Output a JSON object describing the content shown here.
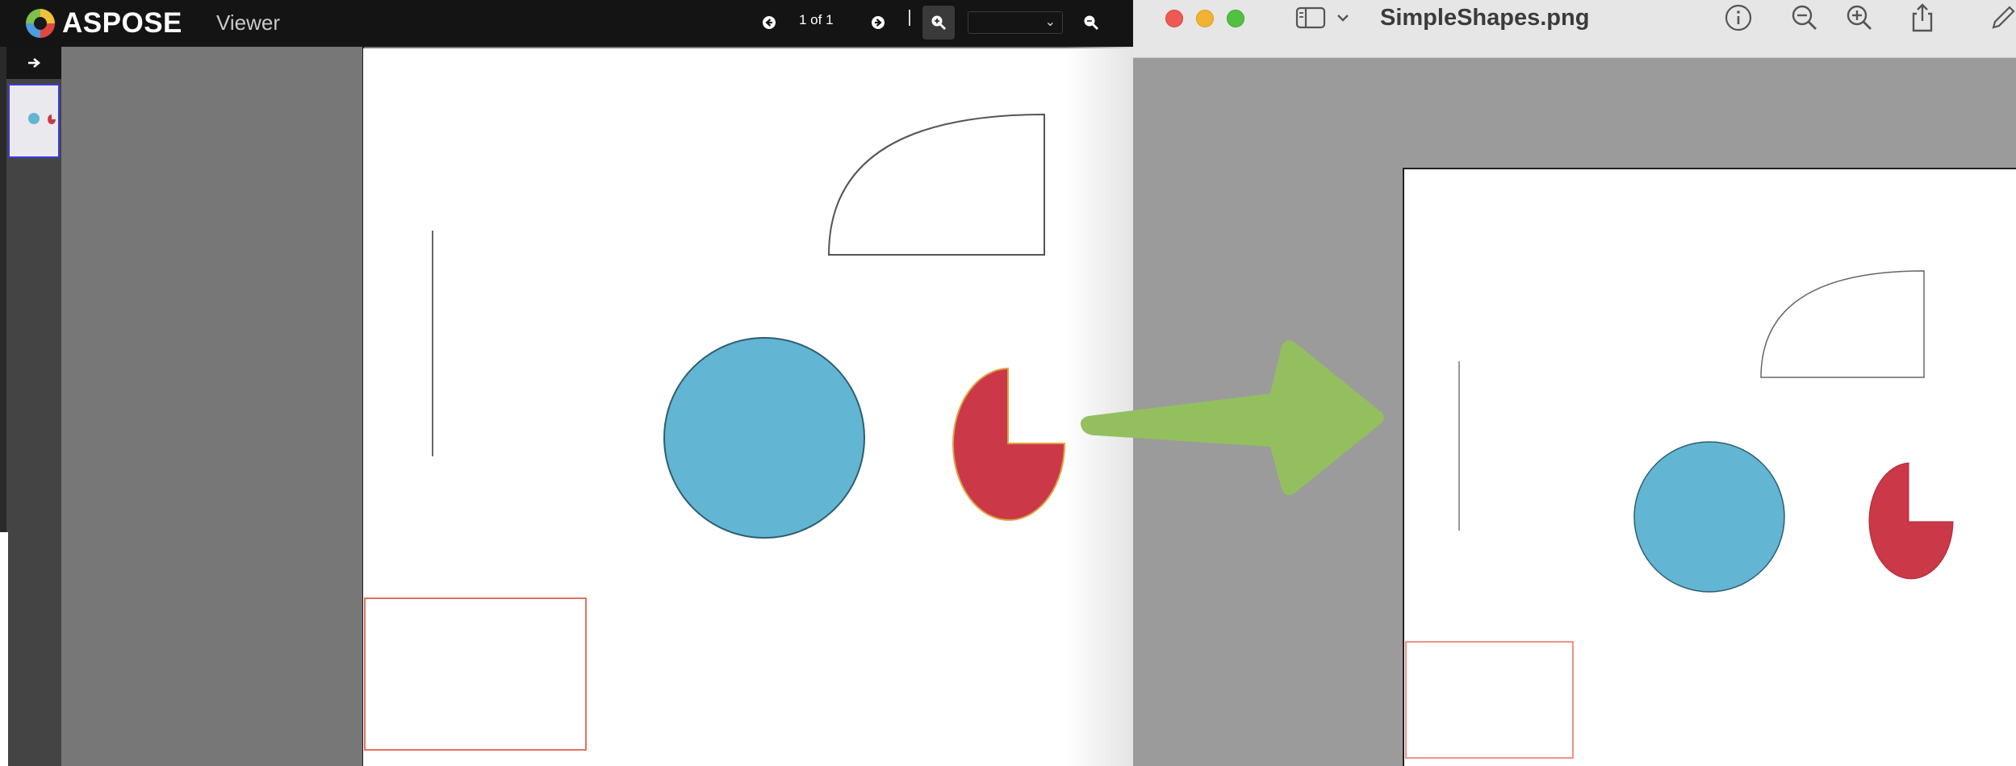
{
  "aspose": {
    "brand": "ASPOSE",
    "app_name": "Viewer",
    "page_indicator": "1 of 1",
    "zoom_value": "",
    "icons": {
      "logo": "aspose-logo-icon",
      "prev": "arrow-left-circle-icon",
      "next": "arrow-right-circle-icon",
      "zoom_in": "zoom-in-icon",
      "zoom_out": "zoom-out-icon",
      "sidebar_toggle": "arrow-right-icon"
    },
    "colors": {
      "topbar": "#141414",
      "circle_fill": "#62b5d3",
      "pie_fill": "#cb3847",
      "rect_stroke": "#e57060",
      "thumb_border": "#3b3bd6"
    }
  },
  "preview": {
    "file_name": "SimpleShapes.png",
    "icons": {
      "close": "close-traffic-light",
      "minimize": "minimize-traffic-light",
      "maximize": "maximize-traffic-light",
      "sidebar": "sidebar-icon",
      "sidebar_menu": "chevron-down-icon",
      "info": "info-icon",
      "zoom_out": "zoom-out-icon",
      "zoom_in": "zoom-in-icon",
      "share": "share-icon",
      "markup": "pencil-icon"
    }
  },
  "arrow": {
    "color": "#94bf5f",
    "icon": "right-arrow-icon"
  }
}
